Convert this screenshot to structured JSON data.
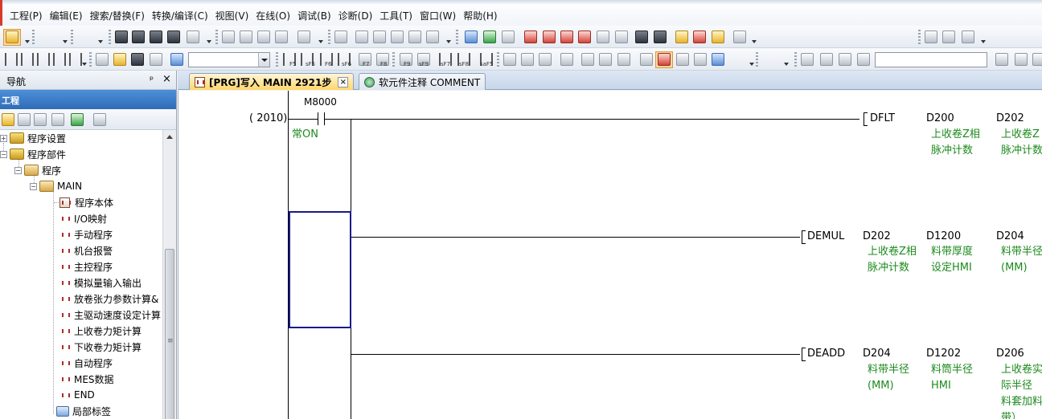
{
  "menu": {
    "items": [
      "工程(P)",
      "编辑(E)",
      "搜索/替换(F)",
      "转换/编译(C)",
      "视图(V)",
      "在线(O)",
      "调试(B)",
      "诊断(D)",
      "工具(T)",
      "窗口(W)",
      "帮助(H)"
    ]
  },
  "toolbar": {
    "fkeys": [
      "F5",
      "sF5",
      "F6",
      "sF6",
      "F7",
      "F8",
      "F9",
      "sF9",
      "sF7",
      "sF8",
      "saF5"
    ]
  },
  "navigation": {
    "title": "导航",
    "pin": "ᵖ",
    "close": "×",
    "project_label": "工程",
    "tree": [
      {
        "label": "程序设置"
      },
      {
        "label": "程序部件"
      },
      {
        "label": "程序"
      },
      {
        "label": "MAIN"
      },
      {
        "label": "程序本体"
      },
      {
        "label": "I/O映射"
      },
      {
        "label": "手动程序"
      },
      {
        "label": "机台报警"
      },
      {
        "label": "主控程序"
      },
      {
        "label": "模拟量输入输出"
      },
      {
        "label": "放卷张力参数计算&"
      },
      {
        "label": "主驱动速度设定计算"
      },
      {
        "label": "上收卷力矩计算"
      },
      {
        "label": "下收卷力矩计算"
      },
      {
        "label": "自动程序"
      },
      {
        "label": "MES数据"
      },
      {
        "label": "END"
      },
      {
        "label": "局部标签"
      }
    ]
  },
  "tabs": [
    {
      "label": "[PRG]写入 MAIN 2921步",
      "close": "×"
    },
    {
      "label": "软元件注释 COMMENT"
    }
  ],
  "ladder": {
    "step": "( 2010)",
    "contact_device": "M8000",
    "contact_comment": "常ON",
    "rungs": [
      {
        "instruction": "DFLT",
        "operands": [
          {
            "device": "D200",
            "comment": [
              "上收卷Z相",
              "脉冲计数"
            ]
          },
          {
            "device": "D202",
            "comment": [
              "上收卷Z",
              "脉冲计数"
            ]
          }
        ]
      },
      {
        "instruction": "DEMUL",
        "operands": [
          {
            "device": "D202",
            "comment": [
              "上收卷Z相",
              "脉冲计数"
            ]
          },
          {
            "device": "D1200",
            "comment": [
              "料带厚度",
              "设定HMI"
            ]
          },
          {
            "device": "D204",
            "comment": [
              "料带半径",
              "(MM)"
            ]
          }
        ]
      },
      {
        "instruction": "DEADD",
        "operands": [
          {
            "device": "D204",
            "comment": [
              "料带半径",
              "(MM)"
            ]
          },
          {
            "device": "D1202",
            "comment": [
              "料筒半径",
              "HMI"
            ]
          },
          {
            "device": "D206",
            "comment": [
              "上收卷实",
              "际半径",
              "料套加料",
              "带）"
            ]
          }
        ]
      }
    ]
  }
}
